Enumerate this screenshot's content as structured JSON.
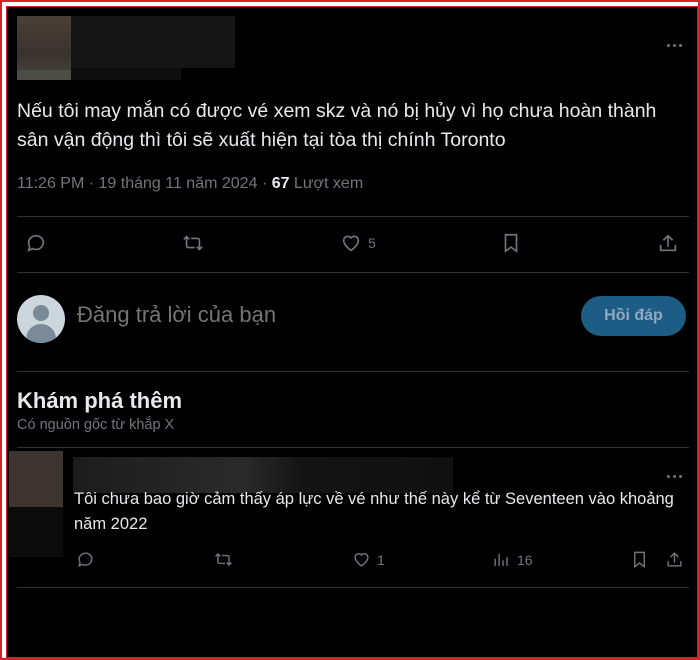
{
  "main_tweet": {
    "text": "Nếu tôi may mắn có được vé xem skz và nó bị hủy vì họ chưa hoàn thành sân vận động thì tôi sẽ xuất hiện tại tòa thị chính Toronto",
    "timestamp": "11:26 PM · 19 tháng 11 năm 2024 · ",
    "views_count": "67",
    "views_label": " Lượt xem",
    "likes": "5"
  },
  "reply_box": {
    "placeholder": "Đăng trả lời của bạn",
    "button_label": "Hồi đáp"
  },
  "discover": {
    "title": "Khám phá thêm",
    "subtitle": "Có nguồn gốc từ khắp X"
  },
  "related_tweet": {
    "text": "Tôi chưa bao giờ cảm thấy áp lực về vé như thế này kể từ Seventeen vào khoảng năm 2022",
    "likes": "1",
    "views": "16"
  },
  "colors": {
    "background": "#000000",
    "text": "#e7e9ea",
    "muted": "#71767b",
    "reply_button": "#1d5c85",
    "border": "#d8222a"
  },
  "icons": [
    "more-icon",
    "reply-icon",
    "retweet-icon",
    "like-icon",
    "bookmark-icon",
    "share-icon",
    "views-icon"
  ]
}
